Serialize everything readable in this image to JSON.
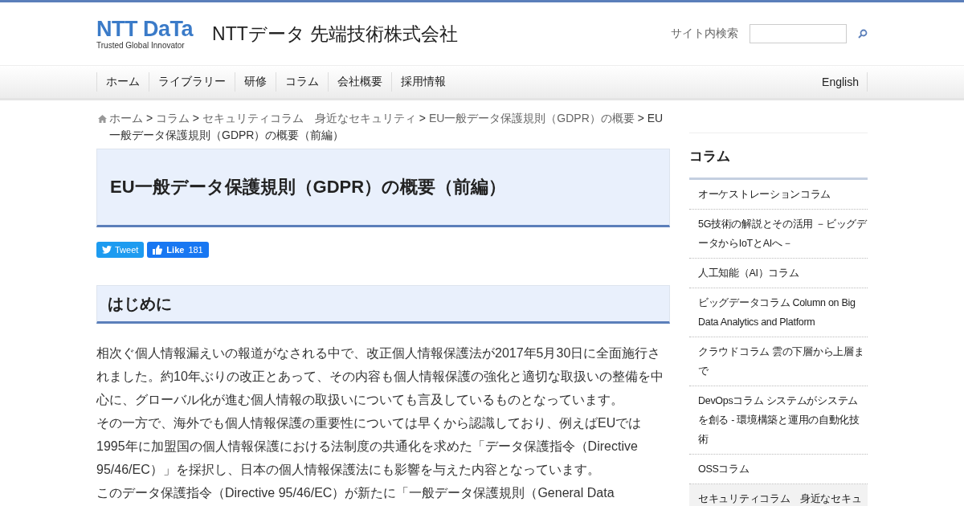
{
  "header": {
    "logo": "NTT DaTa",
    "tagline": "Trusted Global Innovator",
    "company": "NTTデータ 先端技術株式会社",
    "search_label": "サイト内検索"
  },
  "nav": {
    "items": [
      "ホーム",
      "ライブラリー",
      "研修",
      "コラム",
      "会社概要",
      "採用情報"
    ],
    "english": "English"
  },
  "breadcrumb": {
    "separator": ">",
    "links": [
      "ホーム",
      "コラム",
      "セキュリティコラム　身近なセキュリティ",
      "EU一般データ保護規則（GDPR）の概要"
    ],
    "current": "EU一般データ保護規則（GDPR）の概要（前編）"
  },
  "article": {
    "title": "EU一般データ保護規則（GDPR）の概要（前編）",
    "tweet": "Tweet",
    "like": "Like",
    "like_count": "181",
    "section_heading": "はじめに",
    "paragraphs": [
      "相次ぐ個人情報漏えいの報道がなされる中で、改正個人情報保護法が2017年5月30日に全面施行されました。約10年ぶりの改正とあって、その内容も個人情報保護の強化と適切な取扱いの整備を中心に、グローバル化が進む個人情報の取扱いについても言及しているものとなっています。",
      "その一方で、海外でも個人情報保護の重要性については早くから認識しており、例えばEUでは1995年に加盟国の個人情報保護における法制度の共通化を求めた「データ保護指令（Directive 95/46/EC）」を採択し、日本の個人情報保護法にも影響を与えた内容となっています。",
      "このデータ保護指令（Directive 95/46/EC）が新たに「一般データ保護規則（General Data"
    ]
  },
  "sidebar": {
    "title": "コラム",
    "items": [
      {
        "label": "オーケストレーションコラム",
        "selected": false
      },
      {
        "label": "5G技術の解説とその活用 －ビッグデータからIoTとAIへ－",
        "selected": false
      },
      {
        "label": "人工知能（AI）コラム",
        "selected": false
      },
      {
        "label": "ビッグデータコラム Column on Big Data Analytics and Platform",
        "selected": false
      },
      {
        "label": "クラウドコラム 雲の下層から上層まで",
        "selected": false
      },
      {
        "label": "DevOpsコラム システムがシステムを創る - 環境構築と運用の自動化技術",
        "selected": false
      },
      {
        "label": "OSSコラム",
        "selected": false
      },
      {
        "label": "セキュリティコラム　身近なセキュ",
        "selected": true
      }
    ]
  }
}
